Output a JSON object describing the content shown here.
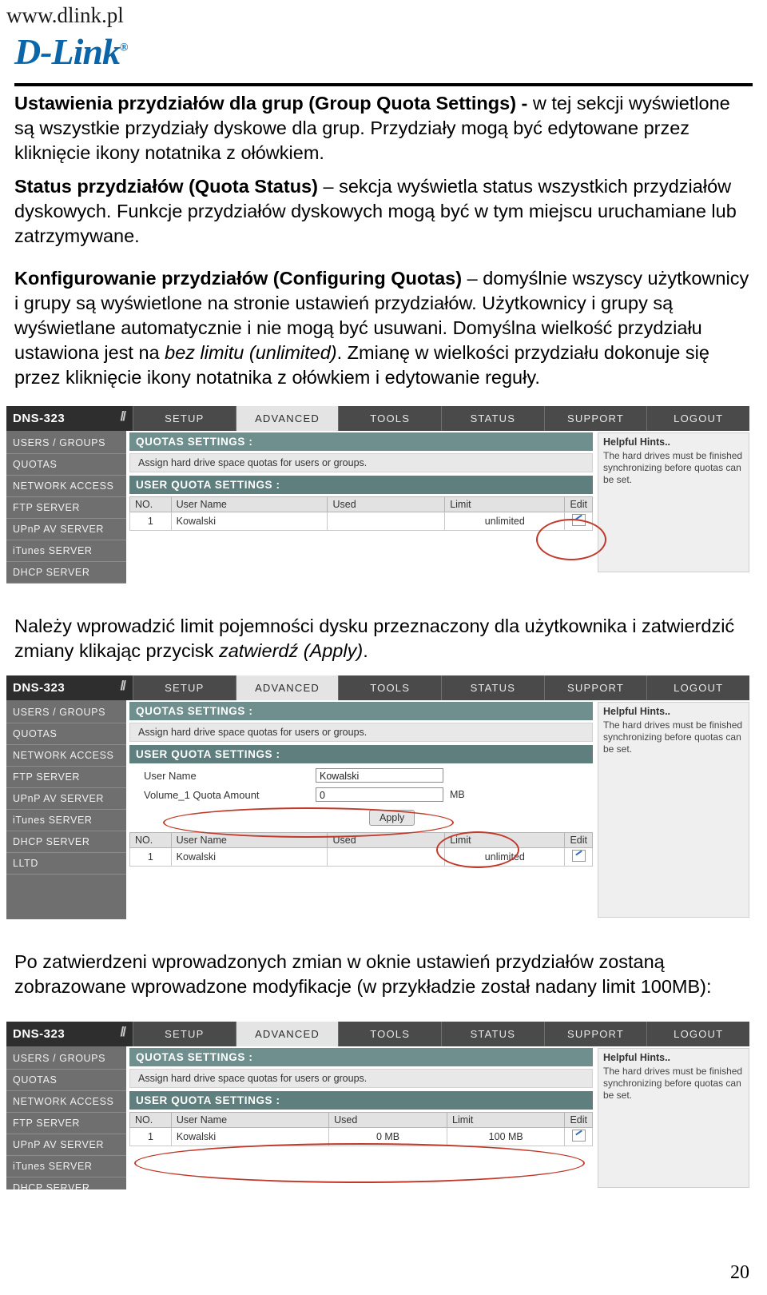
{
  "header": {
    "site_url": "www.dlink.pl",
    "logo_text": "D-Link",
    "logo_reg": "®"
  },
  "paragraphs": {
    "p1_bold": "Ustawienia przydziałów dla grup (Group Quota Settings) -",
    "p1_rest": " w tej sekcji wyświetlone są wszystkie przydziały dyskowe dla grup. Przydziały mogą być edytowane przez kliknięcie ikony notatnika z ołówkiem.",
    "p2_bold": "Status przydziałów (Quota Status)",
    "p2_rest": " – sekcja wyświetla status wszystkich przydziałów dyskowych. Funkcje przydziałów dyskowych mogą być w tym miejscu uruchamiane lub zatrzymywane.",
    "p3_bold": "Konfigurowanie przydziałów (Configuring Quotas)",
    "p3_a": " – domyślnie wszyscy użytkownicy i grupy są wyświetlone na stronie ustawień przydziałów. Użytkownicy i grupy są wyświetlane automatycznie i nie mogą być usuwani. Domyślna wielkość przydziału ustawiona jest na ",
    "p3_i": "bez limitu (unlimited)",
    "p3_b": ". Zmianę w wielkości przydziału dokonuje się przez kliknięcie ikony notatnika z ołówkiem i edytowanie reguły.",
    "p4_a": "Należy wprowadzić limit pojemności dysku przeznaczony dla użytkownika i zatwierdzić zmiany klikając przycisk ",
    "p4_i": "zatwierdź (Apply)",
    "p4_b": ".",
    "p5": "Po zatwierdzeni wprowadzonych zmian w oknie ustawień przydziałów zostaną zobrazowane wprowadzone modyfikacje (w przykładzie został nadany limit 100MB):"
  },
  "ui": {
    "brand": "DNS-323",
    "nav_tabs": [
      "SETUP",
      "ADVANCED",
      "TOOLS",
      "STATUS",
      "SUPPORT",
      "LOGOUT"
    ],
    "active_tab": "ADVANCED",
    "sidebar_short": [
      "USERS / GROUPS",
      "QUOTAS",
      "NETWORK ACCESS",
      "FTP SERVER",
      "UPnP AV SERVER",
      "iTunes SERVER",
      "DHCP SERVER"
    ],
    "sidebar_long": [
      "USERS / GROUPS",
      "QUOTAS",
      "NETWORK ACCESS",
      "FTP SERVER",
      "UPnP AV SERVER",
      "iTunes SERVER",
      "DHCP SERVER",
      "LLTD"
    ],
    "quotas_settings_title": "QUOTAS SETTINGS :",
    "quotas_settings_desc": "Assign hard drive space quotas for users or groups.",
    "user_quota_title": "USER QUOTA SETTINGS :",
    "table_headers": [
      "NO.",
      "User Name",
      "Used",
      "Limit",
      "Edit"
    ],
    "row1_unlimited": [
      "1",
      "Kowalski",
      "",
      "unlimited",
      "edit-icon"
    ],
    "row1_limited": [
      "1",
      "Kowalski",
      "0 MB",
      "100 MB",
      "edit-icon"
    ],
    "form_username_label": "User Name",
    "form_username_value": "Kowalski",
    "form_volume_label": "Volume_1 Quota Amount",
    "form_volume_value": "0",
    "form_unit": "MB",
    "apply_label": "Apply",
    "hints_title": "Helpful Hints..",
    "hints_body": "The hard drives must be finished synchronizing before quotas can be set.",
    "accent_red": "#c0392b",
    "nav_bg": "#4a4a4a",
    "brand_color": "#0a66a8"
  },
  "footer": {
    "page_number": "20"
  }
}
